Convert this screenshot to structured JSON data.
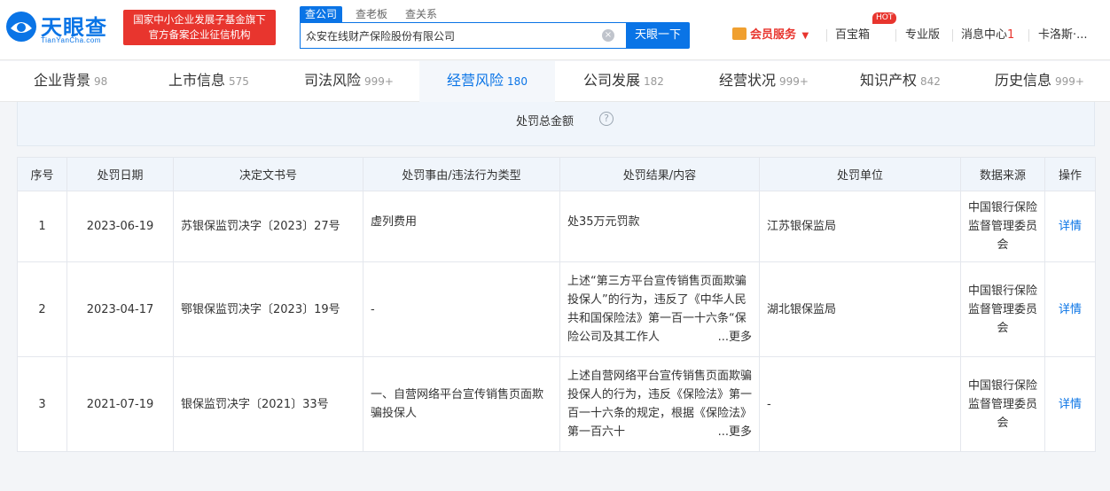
{
  "header": {
    "logo_text": "天眼查",
    "logo_sub": "TianYanCha.com",
    "promo_line1": "国家中小企业发展子基金旗下",
    "promo_line2": "官方备案企业征信机构",
    "search_tabs": [
      "查公司",
      "查老板",
      "查关系"
    ],
    "search_value": "众安在线财产保险股份有限公司",
    "search_clear": "×",
    "search_button": "天眼一下",
    "vip_label": "会员服务",
    "vip_arrow": "▼",
    "baibaoxiang": "百宝箱",
    "hot": "HOT",
    "pro": "专业版",
    "msg_label": "消息中心",
    "msg_count": "1",
    "user": "卡洛斯·..."
  },
  "tabs": [
    {
      "label": "企业背景",
      "count": "98"
    },
    {
      "label": "上市信息",
      "count": "575"
    },
    {
      "label": "司法风险",
      "count": "999+"
    },
    {
      "label": "经营风险",
      "count": "180"
    },
    {
      "label": "公司发展",
      "count": "182"
    },
    {
      "label": "经营状况",
      "count": "999+"
    },
    {
      "label": "知识产权",
      "count": "842"
    },
    {
      "label": "历史信息",
      "count": "999+"
    }
  ],
  "summary": {
    "label": "处罚总金额",
    "help": "?"
  },
  "table": {
    "headers": [
      "序号",
      "处罚日期",
      "决定文书号",
      "处罚事由/违法行为类型",
      "处罚结果/内容",
      "处罚单位",
      "数据来源",
      "操作"
    ],
    "more_label": "...更多",
    "rows": [
      {
        "no": "1",
        "date": "2023-06-19",
        "doc": "苏银保监罚决字〔2023〕27号",
        "reason": "虚列费用",
        "result": "处35万元罚款",
        "unit": "江苏银保监局",
        "source": "中国银行保险监督管理委员会",
        "action": "详情"
      },
      {
        "no": "2",
        "date": "2023-04-17",
        "doc": "鄂银保监罚决字〔2023〕19号",
        "reason": "-",
        "result": "上述“第三方平台宣传销售页面欺骗投保人”的行为，违反了《中华人民共和国保险法》第一百一十六条“保险公司及其工作人",
        "unit": "湖北银保监局",
        "source": "中国银行保险监督管理委员会",
        "action": "详情"
      },
      {
        "no": "3",
        "date": "2021-07-19",
        "doc": "银保监罚决字〔2021〕33号",
        "reason": "一、自营网络平台宣传销售页面欺骗投保人",
        "result": "上述自营网络平台宣传销售页面欺骗投保人的行为，违反《保险法》第一百一十六条的规定，根据《保险法》第一百六十",
        "unit": "-",
        "source": "中国银行保险监督管理委员会",
        "action": "详情"
      }
    ]
  },
  "colors": {
    "brand": "#0a74e6",
    "promo_bg": "#e8352e",
    "header_bg": "#f0f5fb"
  }
}
